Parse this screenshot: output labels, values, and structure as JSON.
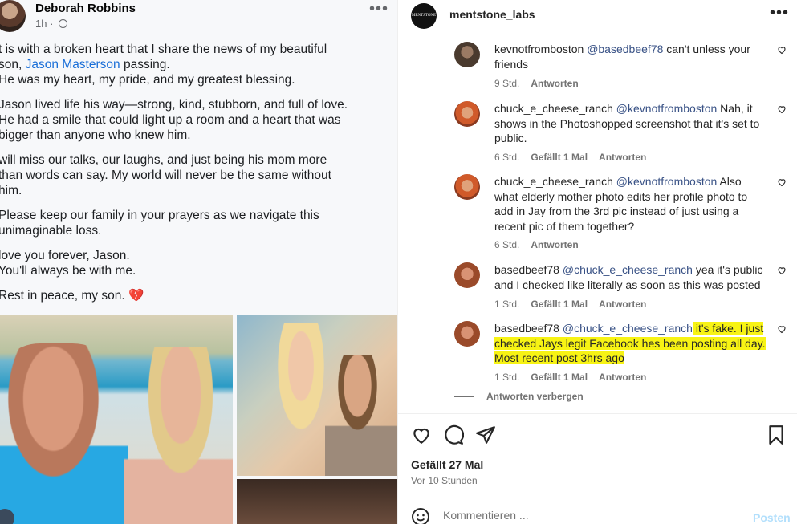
{
  "facebook": {
    "author": "Deborah Robbins",
    "time": "1h",
    "paragraphs": [
      {
        "before": "t is with a broken heart that I share the news of my beautiful\nson, ",
        "link": "Jason Masterson",
        "after": " passing.\nHe was my heart, my pride, and my greatest blessing."
      },
      {
        "before": "Jason lived life his way—strong, kind, stubborn, and full of love.\nHe had a smile that could light up a room and a heart that was\nbigger than anyone who knew him.",
        "link": "",
        "after": ""
      },
      {
        "before": " will miss our talks, our laughs, and just being his mom more\nthan words can say. My world will never be the same without\nhim.",
        "link": "",
        "after": ""
      },
      {
        "before": "Please keep our family in your prayers as we navigate this\nunimaginable loss.",
        "link": "",
        "after": ""
      },
      {
        "before": " love you forever, Jason.\nYou'll always be with me.",
        "link": "",
        "after": ""
      },
      {
        "before": "Rest in peace, my son. ",
        "link": "",
        "after": ""
      }
    ],
    "heart_emoji": "💔"
  },
  "instagram": {
    "account": "mentstone_labs",
    "logo_text": "MENTSTONE LABS",
    "comments": [
      {
        "user": "kevnotfromboston",
        "mention": "@basedbeef78",
        "text": " can't unless your friends",
        "highlight": "",
        "time": "9 Std.",
        "likes": "",
        "reply": "Antworten"
      },
      {
        "user": "chuck_e_cheese_ranch",
        "mention": "@kevnotfromboston",
        "text": " Nah, it shows in the Photoshopped screenshot that it's set to public.",
        "highlight": "",
        "time": "6 Std.",
        "likes": "Gefällt 1 Mal",
        "reply": "Antworten"
      },
      {
        "user": "chuck_e_cheese_ranch",
        "mention": "@kevnotfromboston",
        "text": " Also what elderly mother photo edits her profile photo to add in Jay from the 3rd pic instead of just using a recent pic of them together?",
        "highlight": "",
        "time": "6 Std.",
        "likes": "",
        "reply": "Antworten"
      },
      {
        "user": "basedbeef78",
        "mention": "@chuck_e_cheese_ranch",
        "text": " yea it's public and I checked like literally as soon as this was posted",
        "highlight": "",
        "time": "1 Std.",
        "likes": "Gefällt 1 Mal",
        "reply": "Antworten"
      },
      {
        "user": "basedbeef78",
        "mention": "@chuck_e_cheese_ranch",
        "text": "",
        "highlight": " it's fake. I just checked Jays legit Facebook hes been posting all day. Most recent post 3hrs ago",
        "time": "1 Std.",
        "likes": "Gefällt 1 Mal",
        "reply": "Antworten"
      }
    ],
    "hide_replies": "Antworten verbergen",
    "likes_count": "Gefällt 27 Mal",
    "posted_ago": "Vor 10 Stunden",
    "comment_placeholder": "Kommentieren ...",
    "post_button": "Posten"
  },
  "colors": {
    "highlight": "#f7f314",
    "mention": "#385185",
    "link": "#1b6fd8"
  }
}
